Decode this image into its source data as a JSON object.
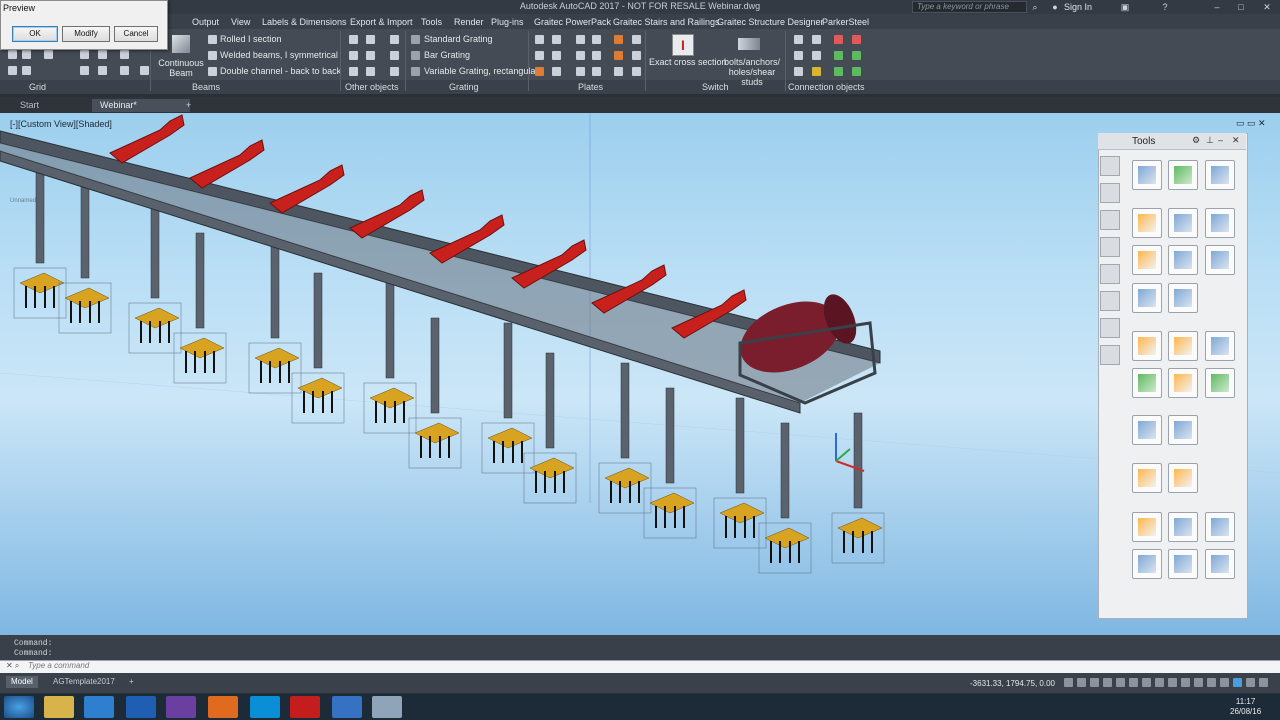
{
  "window": {
    "title": "Autodesk AutoCAD 2017 - NOT FOR RESALE    Webinar.dwg",
    "search_placeholder": "Type a keyword or phrase",
    "signin": "Sign In"
  },
  "menu": [
    "Output",
    "View",
    "Labels & Dimensions",
    "Export & Import",
    "Tools",
    "Render",
    "Plug-ins",
    "Graitec PowerPack",
    "Graitec Stairs and Railings",
    "Graitec Structure Designer",
    "ParkerSteel"
  ],
  "ribbon": {
    "continuous_beam": "Continuous Beam",
    "beam_items": [
      "Rolled I section",
      "Welded beams, I symmetrical",
      "Double channel - back to back"
    ],
    "grating_items": [
      "Standard Grating",
      "Bar Grating",
      "Variable Grating, rectangular"
    ],
    "exact_cross_section": "Exact cross section",
    "bolts": "bolts/anchors/ holes/shear studs",
    "groups": [
      "Grid",
      "Beams",
      "Other objects",
      "Grating",
      "Plates",
      "Switch",
      "Connection objects"
    ]
  },
  "file_tabs": {
    "start": "Start",
    "active": "Webinar*"
  },
  "viewport": {
    "label": "[-][Custom View][Shaded]",
    "unnamed": "Unnamed"
  },
  "preview": {
    "title": "Preview",
    "ok": "OK",
    "modify": "Modify",
    "cancel": "Cancel"
  },
  "tools": {
    "title": "Tools"
  },
  "command": {
    "line1": "Command:",
    "line2": "Command:",
    "placeholder": "Type a command"
  },
  "layout_tabs": [
    "Model",
    "AGTemplate2017"
  ],
  "coords": "-3631.33, 1794.75, 0.00",
  "clock": {
    "time": "11:17",
    "date": "26/08/16"
  },
  "colors": {
    "roller_frame": "#c8211d",
    "beam": "#4d5560",
    "base_plate": "#d9a322",
    "motor": "#7a1e2e"
  }
}
